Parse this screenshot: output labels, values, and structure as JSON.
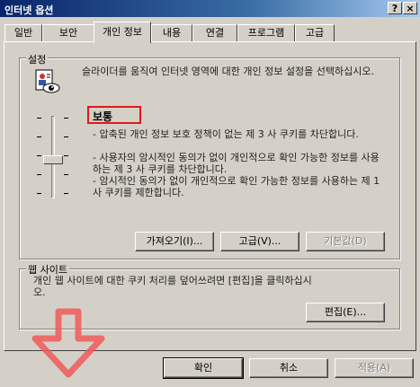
{
  "window": {
    "title": "인터넷 옵션",
    "help_label": "?",
    "close_label": "×"
  },
  "tabs": [
    {
      "label": "일반"
    },
    {
      "label": "보안"
    },
    {
      "label": "개인 정보"
    },
    {
      "label": "내용"
    },
    {
      "label": "연결"
    },
    {
      "label": "프로그램"
    },
    {
      "label": "고급"
    }
  ],
  "settings": {
    "legend": "설정",
    "instruction": "슬라이더를 움직여 인터넷 영역에 대한 개인 정보 설정을 선택하십시오.",
    "level_name": "보통",
    "level_descriptions": [
      "- 압축된 개인 정보 보호 정책이 없는 제 3 사 쿠키를 차단합니다.",
      "- 사용자의 암시적인 동의가 없이 개인적으로 확인 가능한 정보를 사용하는 제 3 사 쿠키를 차단합니다.",
      "- 암시적인 동의가 없이 개인적으로 확인 가능한 정보를 사용하는 제 1 사 쿠키를 제한합니다."
    ],
    "slider_level": 0.5,
    "import_button": "가져오기(I)...",
    "advanced_button": "고급(V)...",
    "default_button": "기본값(D)"
  },
  "websites": {
    "legend": "웹 사이트",
    "description": "개인 웹 사이트에 대한 쿠키 처리를 덮어쓰려면 [편집]을 클릭하십시오.",
    "edit_button": "편집(E)..."
  },
  "footer": {
    "ok_button": "확인",
    "cancel_button": "취소",
    "apply_button": "적용(A)"
  },
  "overlay": {
    "arrow_color": "#ee5a5a",
    "highlight_color": "#e0191b"
  }
}
